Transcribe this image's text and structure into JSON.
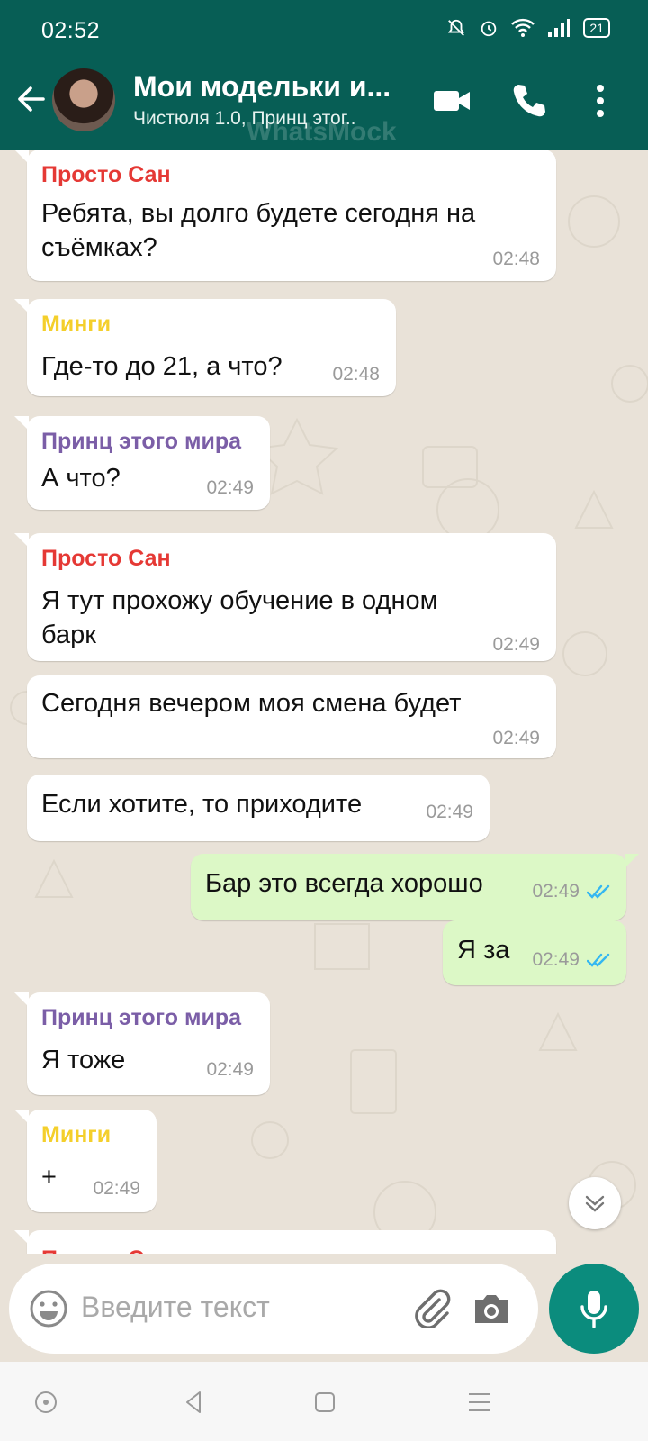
{
  "status": {
    "time": "02:52",
    "battery": "21"
  },
  "header": {
    "title": "Мои модельки и...",
    "subtitle": "Чистюля 1.0, Принц этог..",
    "watermark": "WhatsMock"
  },
  "colors": {
    "header": "#075e55",
    "outgoing": "#dcf8c6",
    "san": "#e53935",
    "mingi": "#f4cf2b",
    "prince": "#7b5ea7",
    "read_ticks": "#34b7f1",
    "mic": "#0b8c7d"
  },
  "messages": [
    {
      "sender": "Просто Сан",
      "lines": [
        "Ребята, вы долго будете сегодня на",
        "съёмках?"
      ],
      "time": "02:48"
    },
    {
      "sender": "Минги",
      "lines": [
        "Где-то до 21, а что?"
      ],
      "time": "02:48"
    },
    {
      "sender": "Принц этого мира",
      "lines": [
        "А что?"
      ],
      "time": "02:49"
    },
    {
      "sender": "Просто Сан",
      "lines": [
        "Я тут прохожу обучение в одном",
        "барк"
      ],
      "time": "02:49"
    },
    {
      "lines": [
        "Сегодня вечером моя смена будет"
      ],
      "time": "02:49"
    },
    {
      "lines": [
        "Если хотите, то приходите"
      ],
      "time": "02:49"
    },
    {
      "lines": [
        "Бар это всегда хорошо"
      ],
      "time": "02:49",
      "status": "read"
    },
    {
      "lines": [
        "Я за"
      ],
      "time": "02:49",
      "status": "read"
    },
    {
      "sender": "Принц этого мира",
      "lines": [
        "Я тоже"
      ],
      "time": "02:49"
    },
    {
      "sender": "Минги",
      "lines": [
        "+"
      ],
      "time": "02:49"
    },
    {
      "sender": "Просто Сан",
      "lines": []
    }
  ],
  "input": {
    "placeholder": "Введите текст"
  }
}
